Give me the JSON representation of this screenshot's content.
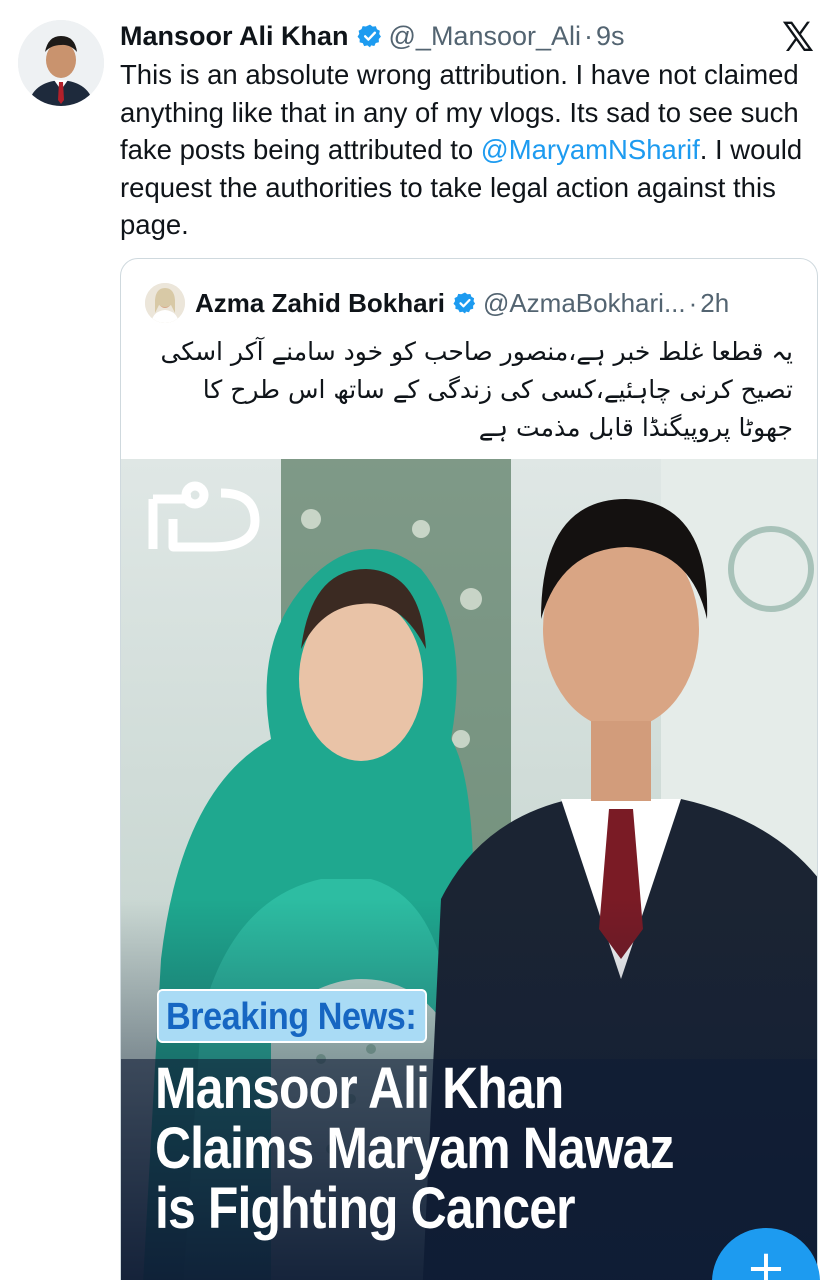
{
  "tweet": {
    "author_name": "Mansoor Ali Khan",
    "handle": "@_Mansoor_Ali",
    "separator": "·",
    "time": "9s",
    "text_before_mention": "This is an absolute wrong attribution. I have not claimed anything like that in any of my vlogs. Its sad to see such fake posts being attributed to ",
    "mention": "@MaryamNSharif",
    "text_after_mention": ". I would request the authorities to take legal action against this page."
  },
  "quoted": {
    "author_name": "Azma Zahid Bokhari",
    "handle": "@AzmaBokhari...",
    "separator": "·",
    "time": "2h",
    "text": "یہ قطعا غلط خبر ہے،منصور صاحب کو خود سامنے آکر اسکی تصیح کرنی چاہئیے،کسی کی زندگی کے ساتھ اس طرح کا جھوٹا پروپیگنڈا قابل مذمت ہے",
    "media": {
      "breaking_label": "Breaking News:",
      "headline_lines": [
        "Mansoor Ali Khan",
        "Claims Maryam Nawaz",
        "is Fighting Cancer"
      ]
    }
  },
  "icons": {
    "x_logo": "𝕏",
    "fab": "+"
  },
  "colors": {
    "accent": "#1d9bf0",
    "secondary_text": "#536471",
    "verified": "#1d9bf0"
  }
}
